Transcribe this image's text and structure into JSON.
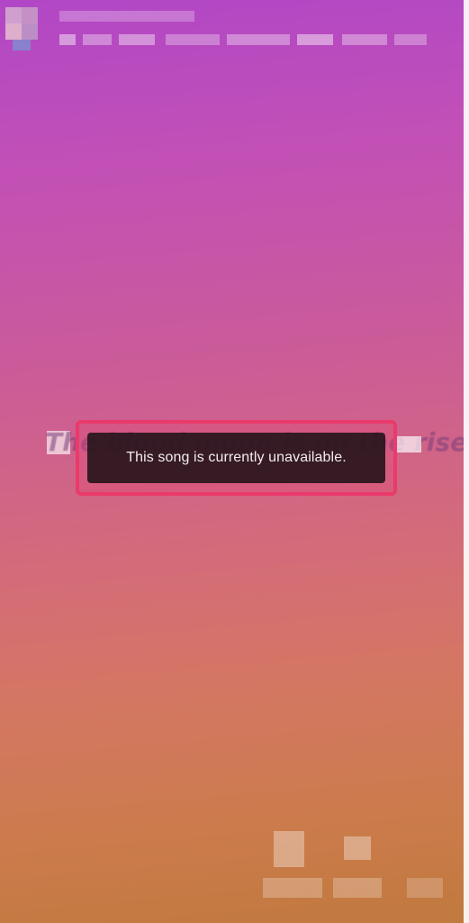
{
  "toast": {
    "message": "This song is currently unavailable."
  },
  "lyric": {
    "text": "The blood moon is on the rise"
  },
  "colors": {
    "gradient_top": "#b147c6",
    "gradient_middle": "#d36a7c",
    "gradient_bottom": "#c07a3e",
    "toast_background": "#28161c",
    "highlight_border": "#ea3a6b"
  },
  "icons": {
    "profile": "avatar-icon",
    "music_note": "music-note-icon"
  }
}
